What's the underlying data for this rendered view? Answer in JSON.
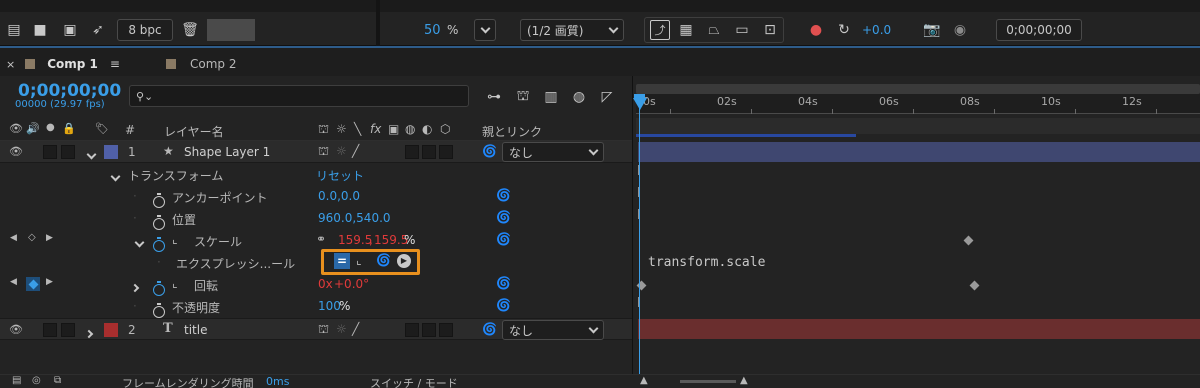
{
  "top_toolbar": {
    "bpc_label": "8 bpc",
    "zoom_value": "50",
    "zoom_unit": "%",
    "resolution_label": "(1/2 画質)",
    "exposure_value": "+0.0",
    "timecode_display": "0;00;00;00"
  },
  "tabs": [
    {
      "label": "Comp 1",
      "active": true
    },
    {
      "label": "Comp 2",
      "active": false
    }
  ],
  "timeline": {
    "current_time": "0;00;00;00",
    "frame_info": "00000 (29.97 fps)",
    "search_placeholder": ""
  },
  "column_headers": {
    "number": "#",
    "layer_name": "レイヤー名",
    "fx": "fx",
    "parent_link": "親とリンク"
  },
  "layers": [
    {
      "number": "1",
      "name": "Shape Layer 1",
      "label_color": "#5060a8",
      "parent": "なし",
      "bar_color": "#3f4770"
    },
    {
      "number": "2",
      "name": "title",
      "label_color": "#a82e2e",
      "parent": "なし",
      "bar_color": "#6a2e2e"
    }
  ],
  "properties": {
    "transform_group": "トランスフォーム",
    "reset": "リセット",
    "anchor_point": {
      "label": "アンカーポイント",
      "value": "0.0,0.0"
    },
    "position": {
      "label": "位置",
      "value": "960.0,540.0"
    },
    "scale": {
      "label": "スケール",
      "value_x": "159.5",
      "sep": ",",
      "value_y": "159.5",
      "unit": "%"
    },
    "expression": {
      "label": "エクスプレッシ...ール",
      "code": "transform.scale"
    },
    "rotation": {
      "label": "回転",
      "value_turns": "0x",
      "value_deg": "+0.0°"
    },
    "opacity": {
      "label": "不透明度",
      "value": "100",
      "unit": "%"
    }
  },
  "ruler": {
    "ticks": [
      "00s",
      "02s",
      "04s",
      "06s",
      "08s",
      "10s",
      "12s"
    ]
  },
  "status_bar": {
    "render_time_label": "フレームレンダリング時間",
    "render_time_value": "0ms",
    "switch_mode_label": "スイッチ / モード"
  },
  "colors": {
    "accent_blue": "#3a9ee8",
    "highlight_orange": "#e8901e",
    "keyframe_value_red": "#e03a3a"
  }
}
